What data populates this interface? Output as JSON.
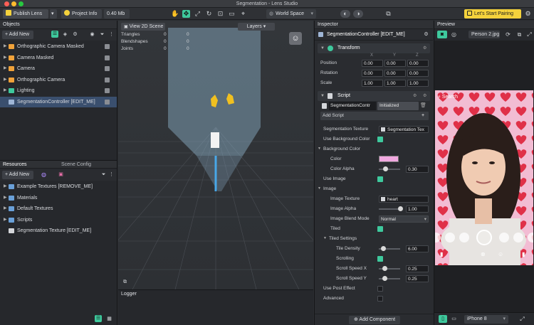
{
  "window": {
    "title": "Segmentation - Lens Studio"
  },
  "toolbar": {
    "publish_label": "Publish Lens",
    "project_info_label": "Project Info",
    "size_badge": "0.40 Mb",
    "space_select": "World Space",
    "pairing_label": "Let's Start Pairing"
  },
  "objects": {
    "title": "Objects",
    "add_label": "Add New",
    "items": [
      {
        "label": "Orthographic Camera Masked",
        "icon_color": "#f0a23a"
      },
      {
        "label": "Camera Masked",
        "icon_color": "#f0a23a"
      },
      {
        "label": "Camera",
        "icon_color": "#f0a23a"
      },
      {
        "label": "Orthographic Camera",
        "icon_color": "#f0a23a"
      },
      {
        "label": "Lighting",
        "icon_color": "#3ec99d"
      },
      {
        "label": "SegmentationController [EDIT_ME]",
        "icon_color": "#9fb6d6"
      }
    ]
  },
  "resources": {
    "tab_resources": "Resources",
    "tab_scene_config": "Scene Config",
    "add_label": "Add New",
    "items": [
      {
        "label": "Example Textures [REMOVE_ME]"
      },
      {
        "label": "Materials"
      },
      {
        "label": "Default Textures"
      },
      {
        "label": "Scripts"
      },
      {
        "label": "Segmentation Texture [EDIT_ME]"
      }
    ]
  },
  "viewport": {
    "view_label": "View 2D Scene",
    "layers_label": "Layers",
    "stats": [
      {
        "name": "Triangles",
        "a": "0",
        "b": "0"
      },
      {
        "name": "Blendshapes",
        "a": "0",
        "b": "0"
      },
      {
        "name": "Joints",
        "a": "0",
        "b": "0"
      }
    ]
  },
  "logger": {
    "title": "Logger"
  },
  "inspector": {
    "title": "Inspector",
    "object_name": "SegmentationController [EDIT_ME]",
    "transform": {
      "title": "Transform",
      "axes": [
        "X",
        "Y",
        "Z"
      ],
      "rows": [
        {
          "label": "Position",
          "x": "0.00",
          "y": "0.00",
          "z": "0.00"
        },
        {
          "label": "Rotation",
          "x": "0.00",
          "y": "0.00",
          "z": "0.00"
        },
        {
          "label": "Scale",
          "x": "1.00",
          "y": "1.00",
          "z": "1.00"
        }
      ]
    },
    "script": {
      "title": "Script",
      "script_name": "SegmentationContr",
      "status": "Initialized",
      "add_script": "Add Script",
      "seg_texture_label": "Segmentation Texture",
      "seg_texture_value": "Segmentation Tex",
      "use_bg_color": "Use Background Color",
      "bg_color_group": "Background Color",
      "color_label": "Color",
      "color_swatch": "#f0a8e0",
      "color_alpha_label": "Color Alpha",
      "color_alpha_value": "0.30",
      "color_alpha_level": 0.3,
      "use_image": "Use Image",
      "image_group": "Image",
      "image_texture_label": "Image Texture",
      "image_texture_value": "heart",
      "image_alpha_label": "Image Alpha",
      "image_alpha_value": "1.00",
      "image_alpha_level": 1.0,
      "blend_mode_label": "Image Blend Mode",
      "blend_mode_value": "Normal",
      "tiled_label": "Tiled",
      "tiled_settings": "Tiled Settings",
      "tile_density_label": "Tile Density",
      "tile_density_value": "6.00",
      "tile_density_level": 0.2,
      "scrolling_label": "Scrolling",
      "scroll_x_label": "Scroll Speed X",
      "scroll_x_value": "0.25",
      "scroll_x_level": 0.25,
      "scroll_y_label": "Scroll Speed Y",
      "scroll_y_value": "0.25",
      "scroll_y_level": 0.25,
      "post_effect_label": "Use Post Effect",
      "advanced_label": "Advanced"
    },
    "add_component": "Add Component"
  },
  "preview": {
    "title": "Preview",
    "person_select": "Person 2.jpg",
    "search_label": "Search",
    "device": "iPhone 8"
  },
  "colors": {
    "accent": "#3ec99d",
    "yellow": "#f4d23c",
    "selection": "#3a4f6e"
  }
}
